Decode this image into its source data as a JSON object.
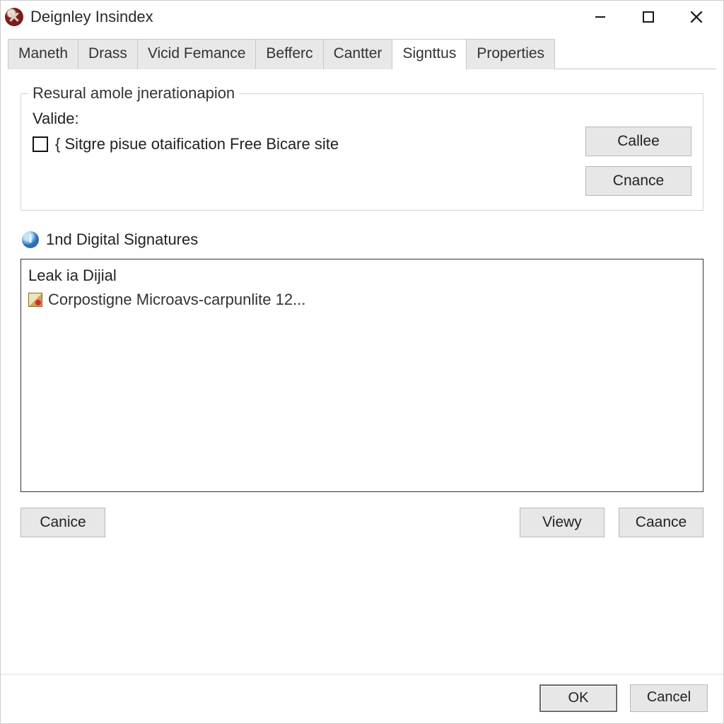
{
  "window": {
    "title": "Deignley Insindex"
  },
  "tabs": [
    {
      "label": "Maneth"
    },
    {
      "label": "Drass"
    },
    {
      "label": "Vicid Femance"
    },
    {
      "label": "Befferc"
    },
    {
      "label": "Cantter"
    },
    {
      "label": "Signttus"
    },
    {
      "label": "Properties"
    }
  ],
  "active_tab_index": 5,
  "group": {
    "legend": "Resural amole jnerationapion",
    "valide_label": "Valide:",
    "checkbox_label": "{ Sitgre pisue otaification Free Bicare site",
    "checkbox_checked": false,
    "buttons": {
      "callee": "Callee",
      "cnance": "Cnance"
    }
  },
  "section_heading": "1nd Digital Signatures",
  "list": {
    "header": "Leak ia Dijial",
    "items": [
      {
        "text": "Corpostigne Microavs-carpunlite 12..."
      }
    ]
  },
  "lower_buttons": {
    "canice": "Canice",
    "viewy": "Viewy",
    "caance": "Caance"
  },
  "dialog_buttons": {
    "ok": "OK",
    "cancel": "Cancel"
  }
}
